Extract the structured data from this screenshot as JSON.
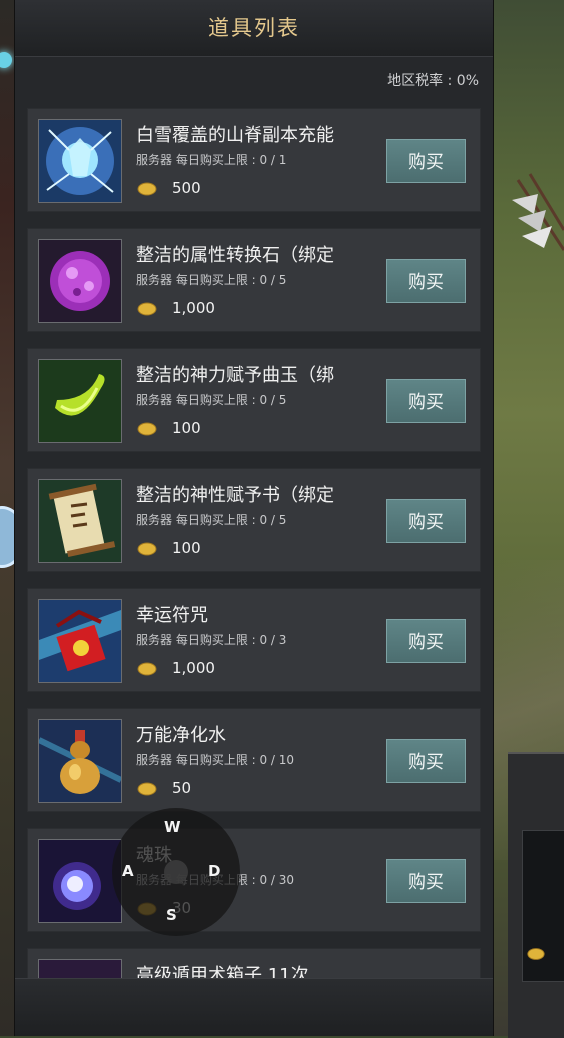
{
  "header": {
    "title": "道具列表"
  },
  "tax": {
    "label": "地区税率 : 0%"
  },
  "items": [
    {
      "name": "白雪覆盖的山脊副本充能",
      "limit": "服务器 每日购买上限 : 0 / 1",
      "price": "500",
      "buy_label": "购买",
      "icon": "snow-ridge-charge-icon"
    },
    {
      "name": "整洁的属性转换石（绑定",
      "limit": "服务器 每日购买上限 : 0 / 5",
      "price": "1,000",
      "buy_label": "购买",
      "icon": "purple-stone-icon"
    },
    {
      "name": "整洁的神力赋予曲玉（绑",
      "limit": "服务器 每日购买上限 : 0 / 5",
      "price": "100",
      "buy_label": "购买",
      "icon": "green-jade-icon"
    },
    {
      "name": "整洁的神性赋予书（绑定",
      "limit": "服务器 每日购买上限 : 0 / 5",
      "price": "100",
      "buy_label": "购买",
      "icon": "scroll-icon"
    },
    {
      "name": "幸运符咒",
      "limit": "服务器 每日购买上限 : 0 / 3",
      "price": "1,000",
      "buy_label": "购买",
      "icon": "lucky-charm-icon"
    },
    {
      "name": "万能净化水",
      "limit": "服务器 每日购买上限 : 0 / 10",
      "price": "50",
      "buy_label": "购买",
      "icon": "gourd-bottle-icon"
    },
    {
      "name": "魂珠",
      "limit": "服务器 每日购买上限 : 0 / 30",
      "price": "30",
      "buy_label": "购买",
      "icon": "soul-orb-icon"
    },
    {
      "name": "高级遁甲术箱子 11次",
      "icon": "chest-icon"
    }
  ],
  "joystick": {
    "up": "W",
    "left": "A",
    "right": "D",
    "down": "S"
  },
  "colors": {
    "title": "#e4c88d",
    "buy_button": "#557a7c",
    "panel": "#26282b",
    "card": "#36383c",
    "coin": "#e0b43a"
  }
}
